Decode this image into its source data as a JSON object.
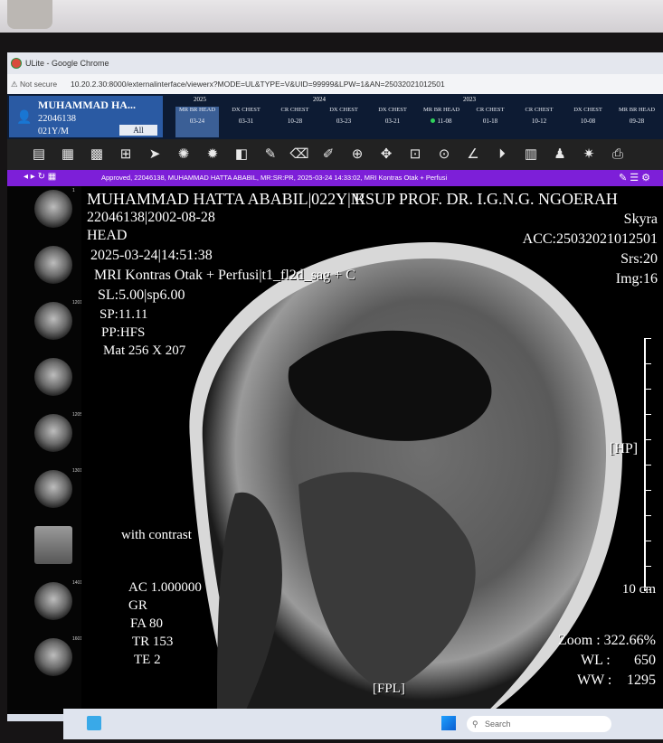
{
  "browser": {
    "title": "ULite - Google Chrome",
    "not_secure": "⚠ Not secure",
    "url": "10.20.2.30:8000/externalinterface/viewerx?MODE=UL&TYPE=V&UID=99999&LPW=1&AN=25032021012501"
  },
  "patient": {
    "name": "MUHAMMAD HA...",
    "id": "22046138",
    "age_sex": "021Y/M",
    "all_button": "All"
  },
  "years": [
    "2025",
    "2024",
    "2023"
  ],
  "studies": [
    {
      "mod": "MR BR HEAD",
      "date": "03-24",
      "selected": true
    },
    {
      "mod": "DX CHEST",
      "date": "03-31"
    },
    {
      "mod": "CR CHEST",
      "date": "10-28"
    },
    {
      "mod": "DX CHEST",
      "date": "03-23"
    },
    {
      "mod": "DX CHEST",
      "date": "03-21"
    },
    {
      "mod": "MR BR HEAD",
      "date": "11-08",
      "dot": true
    },
    {
      "mod": "CR CHEST",
      "date": "01-18"
    },
    {
      "mod": "CR CHEST",
      "date": "10-12"
    },
    {
      "mod": "DX CHEST",
      "date": "10-08"
    },
    {
      "mod": "MR BR HEAD",
      "date": "09-28"
    }
  ],
  "toolbar_icons": [
    "layout-icon",
    "grid-layout-icon",
    "tiles-icon",
    "series-layout-icon",
    "pointer-icon",
    "window-level-icon",
    "preset-window-icon",
    "invert-icon",
    "annotation-pen-icon",
    "eraser-icon",
    "edit-icon",
    "crosshair-icon",
    "pan-icon",
    "zoom-box-icon",
    "magnify-icon",
    "measure-angle-icon",
    "cine-icon",
    "stack-icon",
    "user-icon",
    "effects-icon",
    "capture-icon"
  ],
  "status": {
    "text": "Approved, 22046138, MUHAMMAD HATTA ABABIL, MR:SR:PR, 2025-03-24 14:33:02, MRI Kontras Otak + Perfusi"
  },
  "overlay": {
    "top_left": [
      "MUHAMMAD HATTA ABABIL|022Y|M",
      "22046138|2002-08-28",
      "HEAD",
      "2025-03-24|14:51:38",
      "MRI Kontras Otak + Perfusi|t1_fl2d_sag + C",
      "SL:5.00|sp6.00",
      "SP:11.11",
      "PP:HFS",
      "Mat 256 X 207"
    ],
    "institution": "RSUP PROF. DR. I.G.N.G. NGOERAH",
    "top_right": [
      "Skyra",
      "ACC:25032021012501",
      "Srs:20",
      "Img:16"
    ],
    "orientation_right": "[HP]",
    "orientation_bottom": "[FPL]",
    "with_contrast": "with contrast",
    "bottom_left": [
      "AC 1.000000",
      "GR",
      "FA 80",
      "TR 153",
      "TE 2"
    ],
    "scale": "10 cm",
    "zoom": "Zoom : 322.66%",
    "wl_label": "WL :",
    "wl_value": "650",
    "ww_label": "WW :",
    "ww_value": "1295"
  },
  "thumb_numbers": [
    "1",
    "1201",
    "1205",
    "1301",
    "1401",
    "1301",
    "1601"
  ],
  "taskbar": {
    "search": "Search"
  }
}
